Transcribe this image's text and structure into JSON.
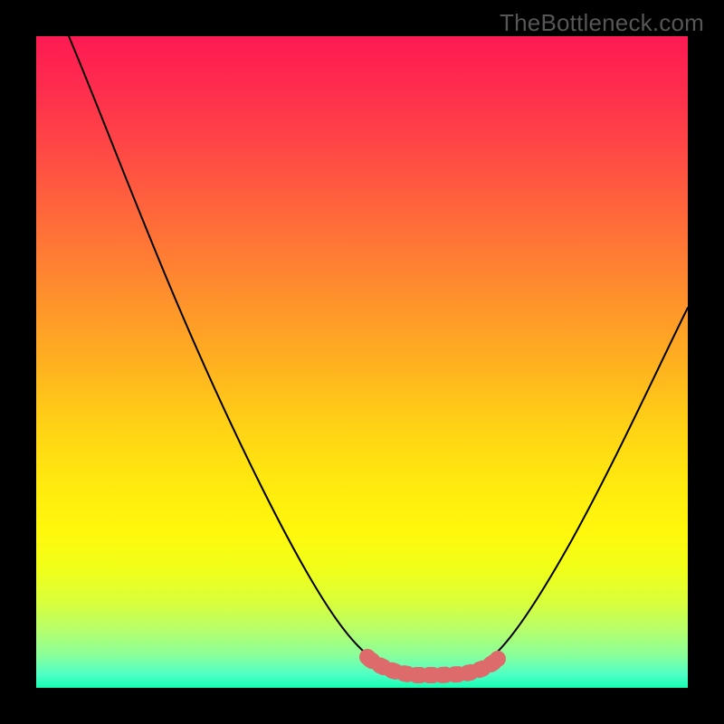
{
  "watermark": "TheBottleneck.com",
  "chart_data": {
    "type": "line",
    "title": "",
    "xlabel": "",
    "ylabel": "",
    "xlim": [
      0,
      100
    ],
    "ylim": [
      0,
      100
    ],
    "series": [
      {
        "name": "curve",
        "color": "#000000",
        "x": [
          5,
          10,
          15,
          20,
          25,
          30,
          35,
          40,
          45,
          50,
          53,
          56,
          60,
          64,
          68,
          70,
          73,
          76,
          80,
          85,
          90,
          95,
          100
        ],
        "y": [
          100,
          90,
          80,
          70,
          60,
          50,
          40,
          30,
          20,
          10,
          5,
          3,
          2,
          2,
          2,
          3,
          5,
          10,
          20,
          32,
          45,
          55,
          60
        ]
      },
      {
        "name": "highlight",
        "color": "#e06666",
        "x": [
          53,
          56,
          60,
          64,
          68,
          70
        ],
        "y": [
          5,
          3,
          2,
          2,
          2,
          3
        ]
      }
    ]
  }
}
